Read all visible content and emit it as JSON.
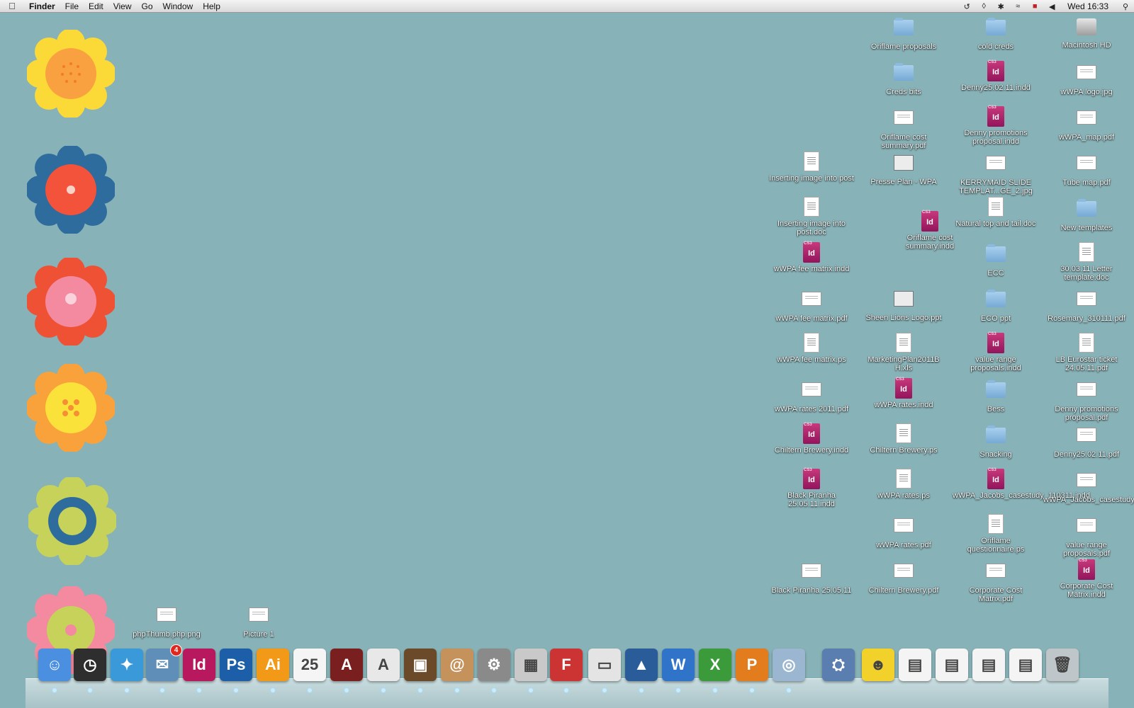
{
  "menubar": {
    "app": "Finder",
    "items": [
      "File",
      "Edit",
      "View",
      "Go",
      "Window",
      "Help"
    ],
    "clock": "Wed 16:33",
    "status_icons": [
      "time-machine-icon",
      "binoculars-icon",
      "bluetooth-icon",
      "wifi-icon",
      "uk-flag-icon",
      "volume-icon",
      "spotlight-icon"
    ]
  },
  "desktop": {
    "background": "#87b2b7",
    "icons": [
      {
        "label": "Oriflame proposals",
        "kind": "folder"
      },
      {
        "label": "cold creds",
        "kind": "folder"
      },
      {
        "label": "Macintosh HD",
        "kind": "disk"
      },
      {
        "label": "Creds bits",
        "kind": "folder"
      },
      {
        "label": "Denny25.02.11.indd",
        "kind": "indd"
      },
      {
        "label": "wWPA logo.jpg",
        "kind": "land"
      },
      {
        "label": "Oriflame cost summary.pdf",
        "kind": "land"
      },
      {
        "label": "Denny promotions proposal.indd",
        "kind": "indd"
      },
      {
        "label": "wWPA_map.pdf",
        "kind": "land"
      },
      {
        "label": "Inserting image into post",
        "kind": "doc"
      },
      {
        "label": "Presse Plan - WPA",
        "kind": "slide"
      },
      {
        "label": "KERRYMAID SLIDE TEMPLAT...GE_2.jpg",
        "kind": "land"
      },
      {
        "label": "Tube map.pdf",
        "kind": "land"
      },
      {
        "label": "Inserting image into post.doc",
        "kind": "doc"
      },
      {
        "label": "Oriflame cost summary.indd",
        "kind": "indd"
      },
      {
        "label": "Natural top and tail.doc",
        "kind": "doc"
      },
      {
        "label": "New templates",
        "kind": "folder"
      },
      {
        "label": "wWPA fee matrix.indd",
        "kind": "indd"
      },
      {
        "label": "ECC",
        "kind": "folder"
      },
      {
        "label": "30.03.11 Letter template.doc",
        "kind": "doc"
      },
      {
        "label": "wWPA fee matrix.pdf",
        "kind": "land"
      },
      {
        "label": "Sheen Lions Logo.ppt",
        "kind": "slide"
      },
      {
        "label": "ECO ppt",
        "kind": "folder"
      },
      {
        "label": "Rosemary_310111.pdf",
        "kind": "land"
      },
      {
        "label": "wWPA fee matrix.ps",
        "kind": "doc"
      },
      {
        "label": "MarketingPlan2011B H.xls",
        "kind": "doc"
      },
      {
        "label": "value range proposals.indd",
        "kind": "indd"
      },
      {
        "label": "LB Eurostar ticket 24.05.11.pdf",
        "kind": "doc"
      },
      {
        "label": "wWPA rates 2011.pdf",
        "kind": "land"
      },
      {
        "label": "wWPA rates.indd",
        "kind": "indd"
      },
      {
        "label": "Bess",
        "kind": "folder"
      },
      {
        "label": "Denny promotions proposal.pdf",
        "kind": "land"
      },
      {
        "label": "Chiltern Brewery.indd",
        "kind": "indd"
      },
      {
        "label": "Chiltern Brewery.ps",
        "kind": "doc"
      },
      {
        "label": "Snacking",
        "kind": "folder"
      },
      {
        "label": "Denny25.02.11.pdf",
        "kind": "land"
      },
      {
        "label": "Black Piranha 25.05.11.indd",
        "kind": "indd"
      },
      {
        "label": "wWPA rates.ps",
        "kind": "doc"
      },
      {
        "label": "wWPA_Jacobs_casestudy_110311.indd",
        "kind": "indd"
      },
      {
        "label": "wWPA_Jacobs_casestudy_110311.pdf",
        "kind": "land"
      },
      {
        "label": "wWPA rates.pdf",
        "kind": "land"
      },
      {
        "label": "Oriflame questionnaire.ps",
        "kind": "doc"
      },
      {
        "label": "value range proposals.pdf",
        "kind": "land"
      },
      {
        "label": "Black Piranha 25.05.11",
        "kind": "land"
      },
      {
        "label": "Chiltern Brewery.pdf",
        "kind": "land"
      },
      {
        "label": "Corporate Cost Matrix.pdf",
        "kind": "land"
      },
      {
        "label": "Corporate Cost Matrix.indd",
        "kind": "indd"
      },
      {
        "label": "phpThumb.php.png",
        "kind": "land"
      },
      {
        "label": "Picture 1",
        "kind": "land"
      }
    ]
  },
  "dock": {
    "items": [
      {
        "name": "Finder",
        "icon": "finder-icon",
        "color": "#4b8fe0",
        "glyph": "☺"
      },
      {
        "name": "Dashboard",
        "icon": "dashboard-icon",
        "color": "#2e2e2e",
        "glyph": "◷"
      },
      {
        "name": "Safari",
        "icon": "safari-icon",
        "color": "#3a9ad9",
        "glyph": "✦"
      },
      {
        "name": "Mail",
        "icon": "mail-icon",
        "color": "#5f8fb8",
        "glyph": "✉",
        "badge": "4"
      },
      {
        "name": "InDesign",
        "icon": "indesign-icon",
        "color": "#b8185e",
        "glyph": "Id"
      },
      {
        "name": "Photoshop",
        "icon": "photoshop-icon",
        "color": "#1c5fa8",
        "glyph": "Ps"
      },
      {
        "name": "Illustrator",
        "icon": "illustrator-icon",
        "color": "#f29a17",
        "glyph": "Ai"
      },
      {
        "name": "iCal",
        "icon": "calendar-icon",
        "color": "#f5f5f5",
        "glyph": "25"
      },
      {
        "name": "Acrobat",
        "icon": "acrobat-pro-icon",
        "color": "#7a1f1f",
        "glyph": "A"
      },
      {
        "name": "Adobe Reader",
        "icon": "adobe-reader-icon",
        "color": "#e8e8e8",
        "glyph": "A"
      },
      {
        "name": "iPhoto",
        "icon": "iphoto-icon",
        "color": "#6b4a2a",
        "glyph": "▣"
      },
      {
        "name": "Address Book",
        "icon": "address-book-icon",
        "color": "#c4925a",
        "glyph": "@"
      },
      {
        "name": "System Preferences",
        "icon": "system-preferences-icon",
        "color": "#8a8a8a",
        "glyph": "⚙"
      },
      {
        "name": "Calculator",
        "icon": "calculator-icon",
        "color": "#c9c9c9",
        "glyph": "▦"
      },
      {
        "name": "Font Book",
        "icon": "font-book-icon",
        "color": "#cc3333",
        "glyph": "F"
      },
      {
        "name": "Printer",
        "icon": "printer-icon",
        "color": "#e4e4e4",
        "glyph": "▭"
      },
      {
        "name": "Keynote",
        "icon": "keynote-icon",
        "color": "#2a5c9a",
        "glyph": "▲"
      },
      {
        "name": "Word",
        "icon": "word-icon",
        "color": "#2f74c9",
        "glyph": "W"
      },
      {
        "name": "Excel",
        "icon": "excel-icon",
        "color": "#3b9b3b",
        "glyph": "X"
      },
      {
        "name": "PowerPoint",
        "icon": "powerpoint-icon",
        "color": "#e27c1d",
        "glyph": "P"
      },
      {
        "name": "Preview",
        "icon": "preview-icon",
        "color": "#9bb6d0",
        "glyph": "◎"
      },
      {
        "name": "Applications",
        "icon": "applications-folder-icon",
        "color": "#5a7eb0",
        "glyph": "⛭"
      },
      {
        "name": "Stack",
        "icon": "spongebob-stack-icon",
        "color": "#f2d22a",
        "glyph": "☻"
      },
      {
        "name": "Document 1",
        "icon": "document-thumbnail-icon",
        "color": "#f4f4f4",
        "glyph": "▤"
      },
      {
        "name": "Document 2",
        "icon": "document-thumbnail-icon",
        "color": "#f4f4f4",
        "glyph": "▤"
      },
      {
        "name": "Document 3",
        "icon": "document-thumbnail-icon",
        "color": "#f4f4f4",
        "glyph": "▤"
      },
      {
        "name": "Document 4",
        "icon": "document-thumbnail-icon",
        "color": "#f4f4f4",
        "glyph": "▤"
      },
      {
        "name": "Trash",
        "icon": "trash-icon",
        "color": "#bfc6c9",
        "glyph": "🗑"
      }
    ]
  }
}
